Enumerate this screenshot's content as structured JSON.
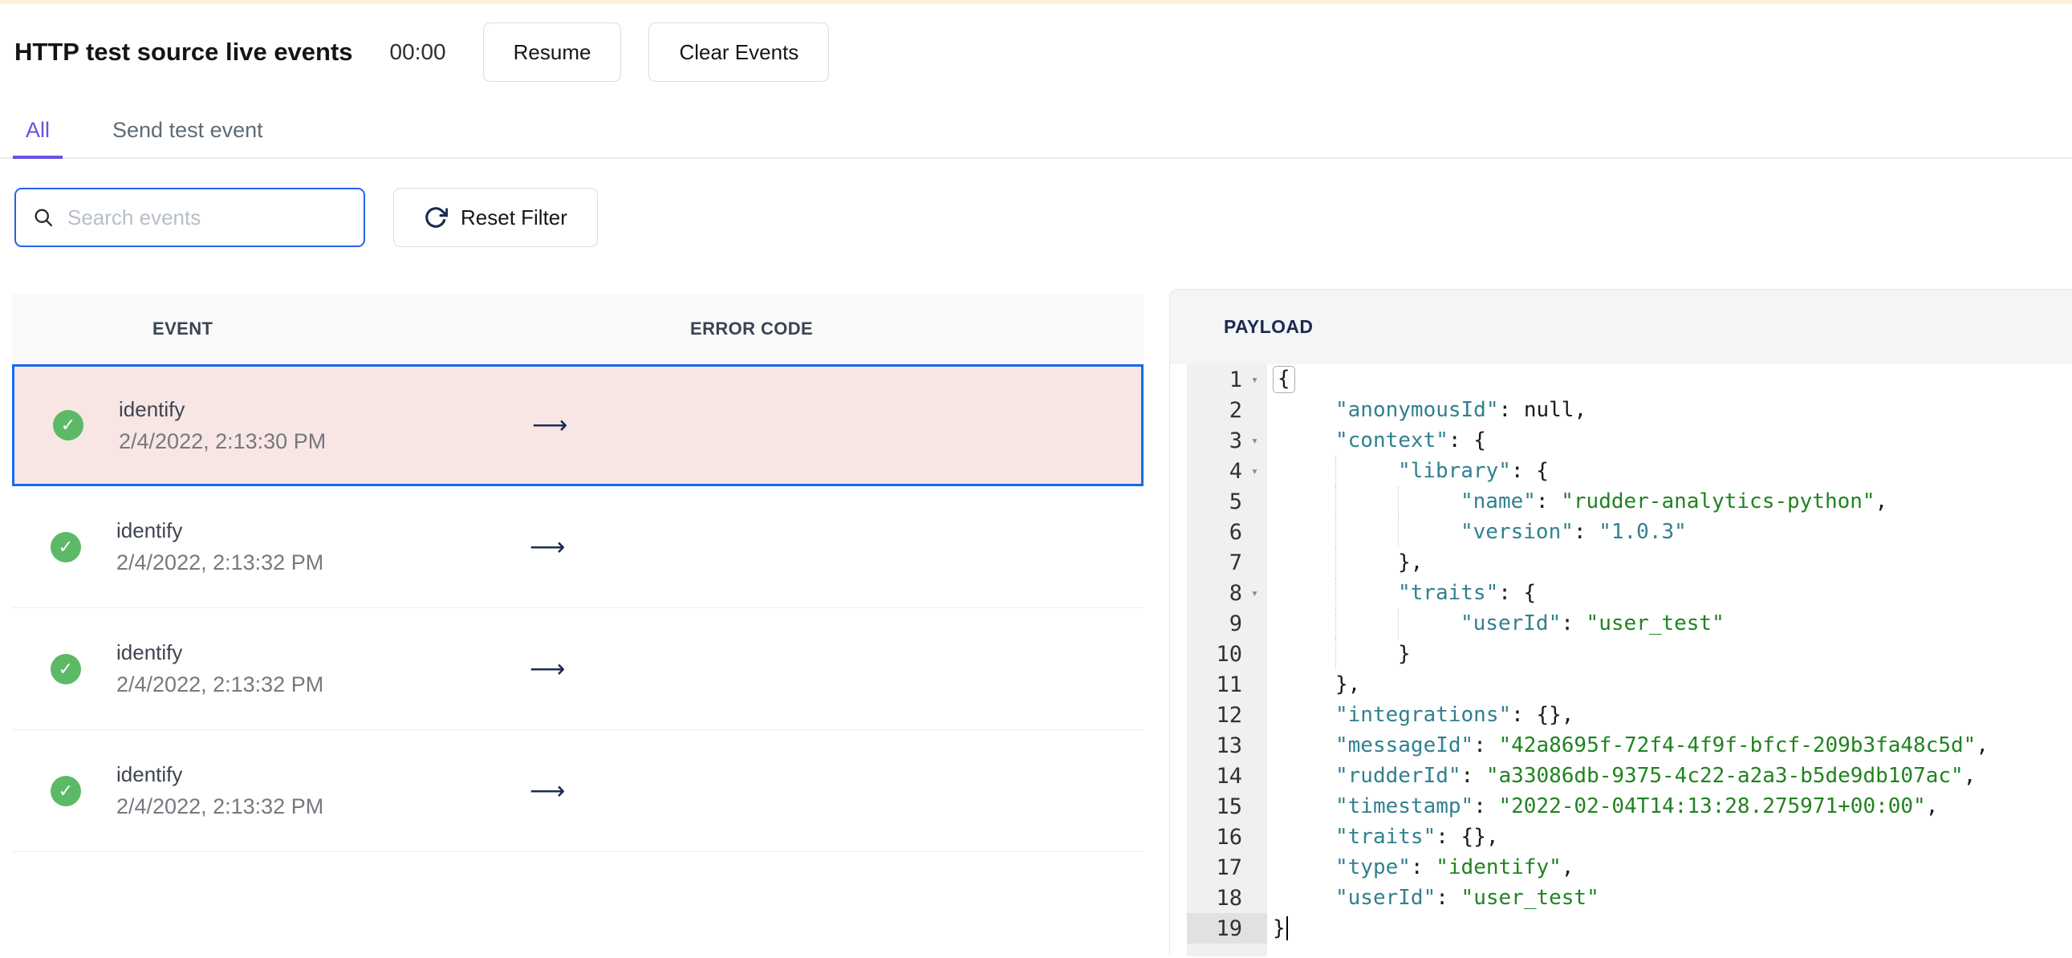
{
  "palette": {
    "accent_purple": "#6C4FE0",
    "focus_blue": "#2563EB",
    "selected_border": "#1669F2",
    "selected_bg": "#F8E6E5",
    "success_green": "#5CB966",
    "key_teal": "#31808F",
    "string_green": "#208320",
    "navy": "#1B2A4E"
  },
  "header": {
    "title": "HTTP test source live events",
    "timer": "00:00",
    "resume_label": "Resume",
    "clear_label": "Clear Events"
  },
  "tabs": [
    {
      "label": "All",
      "active": true
    },
    {
      "label": "Send test event",
      "active": false
    }
  ],
  "filters": {
    "search_placeholder": "Search events",
    "search_value": "",
    "reset_label": "Reset Filter"
  },
  "event_table": {
    "columns": [
      "EVENT",
      "ERROR CODE"
    ],
    "rows": [
      {
        "status": "success",
        "event": "identify",
        "timestamp": "2/4/2022, 2:13:30 PM",
        "selected": true
      },
      {
        "status": "success",
        "event": "identify",
        "timestamp": "2/4/2022, 2:13:32 PM",
        "selected": false
      },
      {
        "status": "success",
        "event": "identify",
        "timestamp": "2/4/2022, 2:13:32 PM",
        "selected": false
      },
      {
        "status": "success",
        "event": "identify",
        "timestamp": "2/4/2022, 2:13:32 PM",
        "selected": false
      }
    ]
  },
  "payload": {
    "title": "PAYLOAD",
    "active_line": 19,
    "lines": [
      {
        "n": 1,
        "fold": true,
        "indent": 0,
        "segs": [
          {
            "t": "brkt",
            "v": "{"
          }
        ]
      },
      {
        "n": 2,
        "indent": 1,
        "segs": [
          {
            "t": "key",
            "v": "\"anonymousId\""
          },
          {
            "t": "p",
            "v": ": "
          },
          {
            "t": "atom",
            "v": "null"
          },
          {
            "t": "p",
            "v": ","
          }
        ]
      },
      {
        "n": 3,
        "fold": true,
        "indent": 1,
        "segs": [
          {
            "t": "key",
            "v": "\"context\""
          },
          {
            "t": "p",
            "v": ": {"
          }
        ]
      },
      {
        "n": 4,
        "fold": true,
        "indent": 2,
        "segs": [
          {
            "t": "key",
            "v": "\"library\""
          },
          {
            "t": "p",
            "v": ": {"
          }
        ]
      },
      {
        "n": 5,
        "indent": 3,
        "segs": [
          {
            "t": "key",
            "v": "\"name\""
          },
          {
            "t": "p",
            "v": ": "
          },
          {
            "t": "str",
            "v": "\"rudder-analytics-python\""
          },
          {
            "t": "p",
            "v": ","
          }
        ]
      },
      {
        "n": 6,
        "indent": 3,
        "segs": [
          {
            "t": "key",
            "v": "\"version\""
          },
          {
            "t": "p",
            "v": ": "
          },
          {
            "t": "str2",
            "v": "\"1.0.3\""
          }
        ]
      },
      {
        "n": 7,
        "indent": 2,
        "segs": [
          {
            "t": "p",
            "v": "},"
          }
        ]
      },
      {
        "n": 8,
        "fold": true,
        "indent": 2,
        "segs": [
          {
            "t": "key",
            "v": "\"traits\""
          },
          {
            "t": "p",
            "v": ": {"
          }
        ]
      },
      {
        "n": 9,
        "indent": 3,
        "segs": [
          {
            "t": "key",
            "v": "\"userId\""
          },
          {
            "t": "p",
            "v": ": "
          },
          {
            "t": "str",
            "v": "\"user_test\""
          }
        ]
      },
      {
        "n": 10,
        "indent": 2,
        "segs": [
          {
            "t": "p",
            "v": "}"
          }
        ]
      },
      {
        "n": 11,
        "indent": 1,
        "segs": [
          {
            "t": "p",
            "v": "},"
          }
        ]
      },
      {
        "n": 12,
        "indent": 1,
        "segs": [
          {
            "t": "key",
            "v": "\"integrations\""
          },
          {
            "t": "p",
            "v": ": {},"
          }
        ]
      },
      {
        "n": 13,
        "indent": 1,
        "segs": [
          {
            "t": "key",
            "v": "\"messageId\""
          },
          {
            "t": "p",
            "v": ": "
          },
          {
            "t": "str",
            "v": "\"42a8695f-72f4-4f9f-bfcf-209b3fa48c5d\""
          },
          {
            "t": "p",
            "v": ","
          }
        ]
      },
      {
        "n": 14,
        "indent": 1,
        "segs": [
          {
            "t": "key",
            "v": "\"rudderId\""
          },
          {
            "t": "p",
            "v": ": "
          },
          {
            "t": "str",
            "v": "\"a33086db-9375-4c22-a2a3-b5de9db107ac\""
          },
          {
            "t": "p",
            "v": ","
          }
        ]
      },
      {
        "n": 15,
        "indent": 1,
        "segs": [
          {
            "t": "key",
            "v": "\"timestamp\""
          },
          {
            "t": "p",
            "v": ": "
          },
          {
            "t": "str",
            "v": "\"2022-02-04T14:13:28.275971+00:00\""
          },
          {
            "t": "p",
            "v": ","
          }
        ]
      },
      {
        "n": 16,
        "indent": 1,
        "segs": [
          {
            "t": "key",
            "v": "\"traits\""
          },
          {
            "t": "p",
            "v": ": {},"
          }
        ]
      },
      {
        "n": 17,
        "indent": 1,
        "segs": [
          {
            "t": "key",
            "v": "\"type\""
          },
          {
            "t": "p",
            "v": ": "
          },
          {
            "t": "str",
            "v": "\"identify\""
          },
          {
            "t": "p",
            "v": ","
          }
        ]
      },
      {
        "n": 18,
        "indent": 1,
        "segs": [
          {
            "t": "key",
            "v": "\"userId\""
          },
          {
            "t": "p",
            "v": ": "
          },
          {
            "t": "str",
            "v": "\"user_test\""
          }
        ]
      },
      {
        "n": 19,
        "indent": 0,
        "cursor": true,
        "segs": [
          {
            "t": "p",
            "v": "}"
          }
        ]
      }
    ]
  }
}
